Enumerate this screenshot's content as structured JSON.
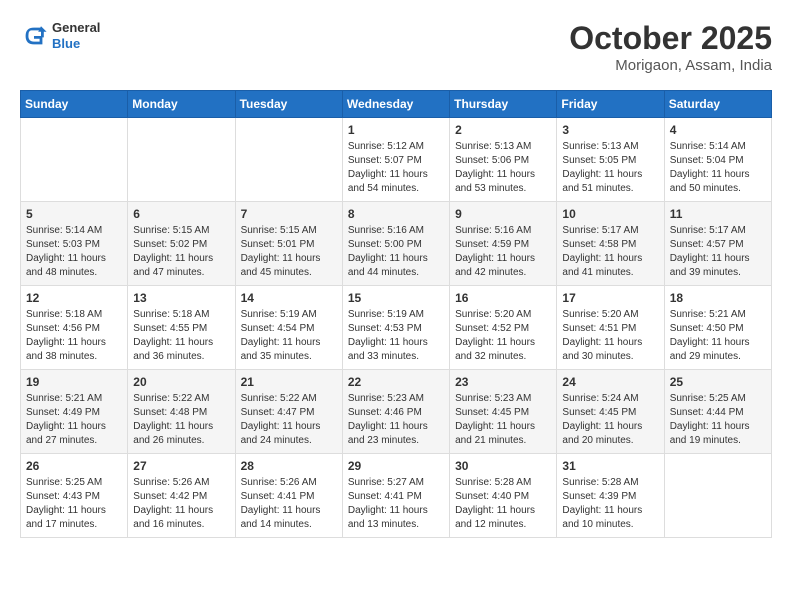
{
  "header": {
    "logo_general": "General",
    "logo_blue": "Blue",
    "month": "October 2025",
    "location": "Morigaon, Assam, India"
  },
  "days_of_week": [
    "Sunday",
    "Monday",
    "Tuesday",
    "Wednesday",
    "Thursday",
    "Friday",
    "Saturday"
  ],
  "weeks": [
    [
      {
        "day": "",
        "content": ""
      },
      {
        "day": "",
        "content": ""
      },
      {
        "day": "",
        "content": ""
      },
      {
        "day": "1",
        "content": "Sunrise: 5:12 AM\nSunset: 5:07 PM\nDaylight: 11 hours and 54 minutes."
      },
      {
        "day": "2",
        "content": "Sunrise: 5:13 AM\nSunset: 5:06 PM\nDaylight: 11 hours and 53 minutes."
      },
      {
        "day": "3",
        "content": "Sunrise: 5:13 AM\nSunset: 5:05 PM\nDaylight: 11 hours and 51 minutes."
      },
      {
        "day": "4",
        "content": "Sunrise: 5:14 AM\nSunset: 5:04 PM\nDaylight: 11 hours and 50 minutes."
      }
    ],
    [
      {
        "day": "5",
        "content": "Sunrise: 5:14 AM\nSunset: 5:03 PM\nDaylight: 11 hours and 48 minutes."
      },
      {
        "day": "6",
        "content": "Sunrise: 5:15 AM\nSunset: 5:02 PM\nDaylight: 11 hours and 47 minutes."
      },
      {
        "day": "7",
        "content": "Sunrise: 5:15 AM\nSunset: 5:01 PM\nDaylight: 11 hours and 45 minutes."
      },
      {
        "day": "8",
        "content": "Sunrise: 5:16 AM\nSunset: 5:00 PM\nDaylight: 11 hours and 44 minutes."
      },
      {
        "day": "9",
        "content": "Sunrise: 5:16 AM\nSunset: 4:59 PM\nDaylight: 11 hours and 42 minutes."
      },
      {
        "day": "10",
        "content": "Sunrise: 5:17 AM\nSunset: 4:58 PM\nDaylight: 11 hours and 41 minutes."
      },
      {
        "day": "11",
        "content": "Sunrise: 5:17 AM\nSunset: 4:57 PM\nDaylight: 11 hours and 39 minutes."
      }
    ],
    [
      {
        "day": "12",
        "content": "Sunrise: 5:18 AM\nSunset: 4:56 PM\nDaylight: 11 hours and 38 minutes."
      },
      {
        "day": "13",
        "content": "Sunrise: 5:18 AM\nSunset: 4:55 PM\nDaylight: 11 hours and 36 minutes."
      },
      {
        "day": "14",
        "content": "Sunrise: 5:19 AM\nSunset: 4:54 PM\nDaylight: 11 hours and 35 minutes."
      },
      {
        "day": "15",
        "content": "Sunrise: 5:19 AM\nSunset: 4:53 PM\nDaylight: 11 hours and 33 minutes."
      },
      {
        "day": "16",
        "content": "Sunrise: 5:20 AM\nSunset: 4:52 PM\nDaylight: 11 hours and 32 minutes."
      },
      {
        "day": "17",
        "content": "Sunrise: 5:20 AM\nSunset: 4:51 PM\nDaylight: 11 hours and 30 minutes."
      },
      {
        "day": "18",
        "content": "Sunrise: 5:21 AM\nSunset: 4:50 PM\nDaylight: 11 hours and 29 minutes."
      }
    ],
    [
      {
        "day": "19",
        "content": "Sunrise: 5:21 AM\nSunset: 4:49 PM\nDaylight: 11 hours and 27 minutes."
      },
      {
        "day": "20",
        "content": "Sunrise: 5:22 AM\nSunset: 4:48 PM\nDaylight: 11 hours and 26 minutes."
      },
      {
        "day": "21",
        "content": "Sunrise: 5:22 AM\nSunset: 4:47 PM\nDaylight: 11 hours and 24 minutes."
      },
      {
        "day": "22",
        "content": "Sunrise: 5:23 AM\nSunset: 4:46 PM\nDaylight: 11 hours and 23 minutes."
      },
      {
        "day": "23",
        "content": "Sunrise: 5:23 AM\nSunset: 4:45 PM\nDaylight: 11 hours and 21 minutes."
      },
      {
        "day": "24",
        "content": "Sunrise: 5:24 AM\nSunset: 4:45 PM\nDaylight: 11 hours and 20 minutes."
      },
      {
        "day": "25",
        "content": "Sunrise: 5:25 AM\nSunset: 4:44 PM\nDaylight: 11 hours and 19 minutes."
      }
    ],
    [
      {
        "day": "26",
        "content": "Sunrise: 5:25 AM\nSunset: 4:43 PM\nDaylight: 11 hours and 17 minutes."
      },
      {
        "day": "27",
        "content": "Sunrise: 5:26 AM\nSunset: 4:42 PM\nDaylight: 11 hours and 16 minutes."
      },
      {
        "day": "28",
        "content": "Sunrise: 5:26 AM\nSunset: 4:41 PM\nDaylight: 11 hours and 14 minutes."
      },
      {
        "day": "29",
        "content": "Sunrise: 5:27 AM\nSunset: 4:41 PM\nDaylight: 11 hours and 13 minutes."
      },
      {
        "day": "30",
        "content": "Sunrise: 5:28 AM\nSunset: 4:40 PM\nDaylight: 11 hours and 12 minutes."
      },
      {
        "day": "31",
        "content": "Sunrise: 5:28 AM\nSunset: 4:39 PM\nDaylight: 11 hours and 10 minutes."
      },
      {
        "day": "",
        "content": ""
      }
    ]
  ]
}
